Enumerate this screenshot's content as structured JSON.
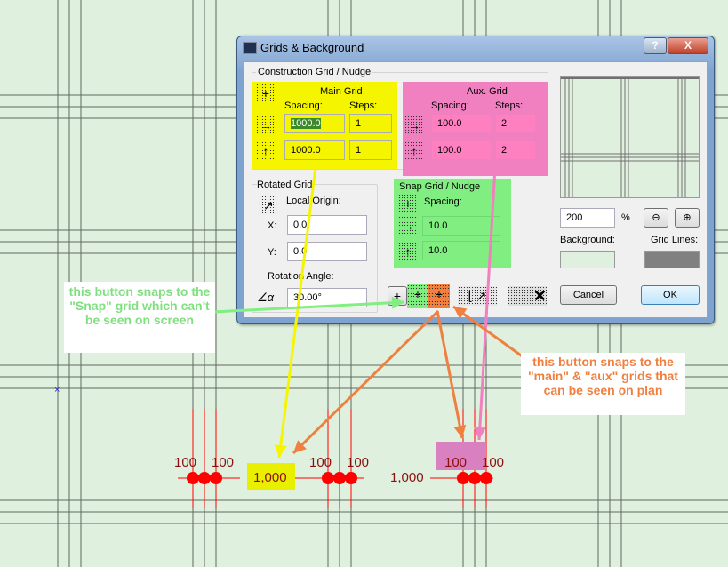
{
  "dialog": {
    "title": "Grids & Background",
    "help_label": "?",
    "close_label": "X",
    "construction_group": "Construction Grid / Nudge",
    "main_grid": {
      "title": "Main Grid",
      "spacing_label": "Spacing:",
      "steps_label": "Steps:",
      "x_spacing": "1000.0",
      "x_steps": "1",
      "y_spacing": "1000.0",
      "y_steps": "1"
    },
    "aux_grid": {
      "title": "Aux. Grid",
      "spacing_label": "Spacing:",
      "steps_label": "Steps:",
      "x_spacing": "100.0",
      "x_steps": "2",
      "y_spacing": "100.0",
      "y_steps": "2"
    },
    "rotated_grid": {
      "title": "Rotated Grid",
      "origin_label": "Local Origin:",
      "x_label": "X:",
      "x_value": "0.0",
      "y_label": "Y:",
      "y_value": "0.0",
      "angle_label": "Rotation Angle:",
      "angle_value": "30.00°"
    },
    "snap_grid": {
      "title": "Snap Grid / Nudge",
      "spacing_label": "Spacing:",
      "x_spacing": "10.0",
      "y_spacing": "10.0"
    },
    "zoom_value": "200",
    "zoom_unit": "%",
    "background_label": "Background:",
    "grid_lines_label": "Grid Lines:",
    "background_color": "#e0f0de",
    "grid_lines_color": "#808080",
    "cancel_label": "Cancel",
    "ok_label": "OK"
  },
  "annotations": {
    "snap_note": "this button snaps to the \"Snap\" grid which can't be seen on screen",
    "main_aux_note": "this button snaps to the \"main\" & \"aux\" grids that can be seen on plan"
  },
  "dimensions": [
    "100",
    "100",
    "1,000",
    "100",
    "100",
    "1,000",
    "100",
    "100"
  ],
  "colors": {
    "main": "#f5f500",
    "aux": "#f080c0",
    "snap": "#80ee80",
    "orange": "#f08040",
    "dim_red": "#ff0000"
  }
}
